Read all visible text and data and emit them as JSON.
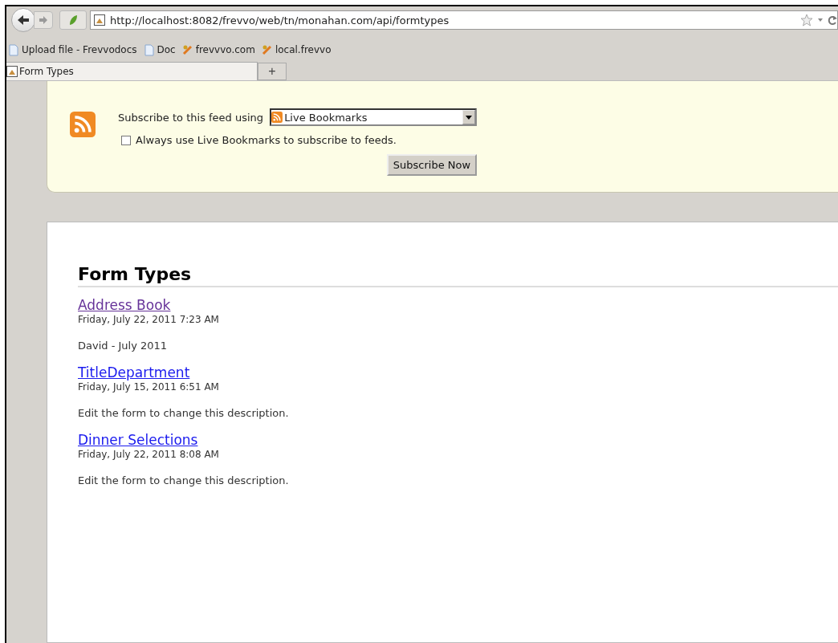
{
  "toolbar": {
    "url": "http://localhost:8082/frevvo/web/tn/monahan.com/api/formtypes"
  },
  "bookmarks": [
    {
      "label": "Upload file - Frevvodocs",
      "kind": "page"
    },
    {
      "label": "Doc",
      "kind": "page"
    },
    {
      "label": "frevvvo.com",
      "kind": "site"
    },
    {
      "label": "local.frevvo",
      "kind": "site"
    }
  ],
  "tabs": [
    {
      "label": "Form Types",
      "selected": true
    }
  ],
  "new_tab": "+",
  "subscribe": {
    "prompt": "Subscribe to this feed using",
    "reader": "Live Bookmarks",
    "always_label": "Always use Live Bookmarks to subscribe to feeds.",
    "always_checked": false,
    "button": "Subscribe Now"
  },
  "feed": {
    "title": "Form Types",
    "entries": [
      {
        "title": "Address Book",
        "visited": true,
        "date": "Friday, July 22, 2011 7:23 AM",
        "description": "David - July 2011"
      },
      {
        "title": "TitleDepartment",
        "visited": false,
        "date": "Friday, July 15, 2011 6:51 AM",
        "description": "Edit the form to change this description."
      },
      {
        "title": "Dinner Selections",
        "visited": false,
        "date": "Friday, July 22, 2011 8:08 AM",
        "description": "Edit the form to change this description."
      }
    ]
  }
}
